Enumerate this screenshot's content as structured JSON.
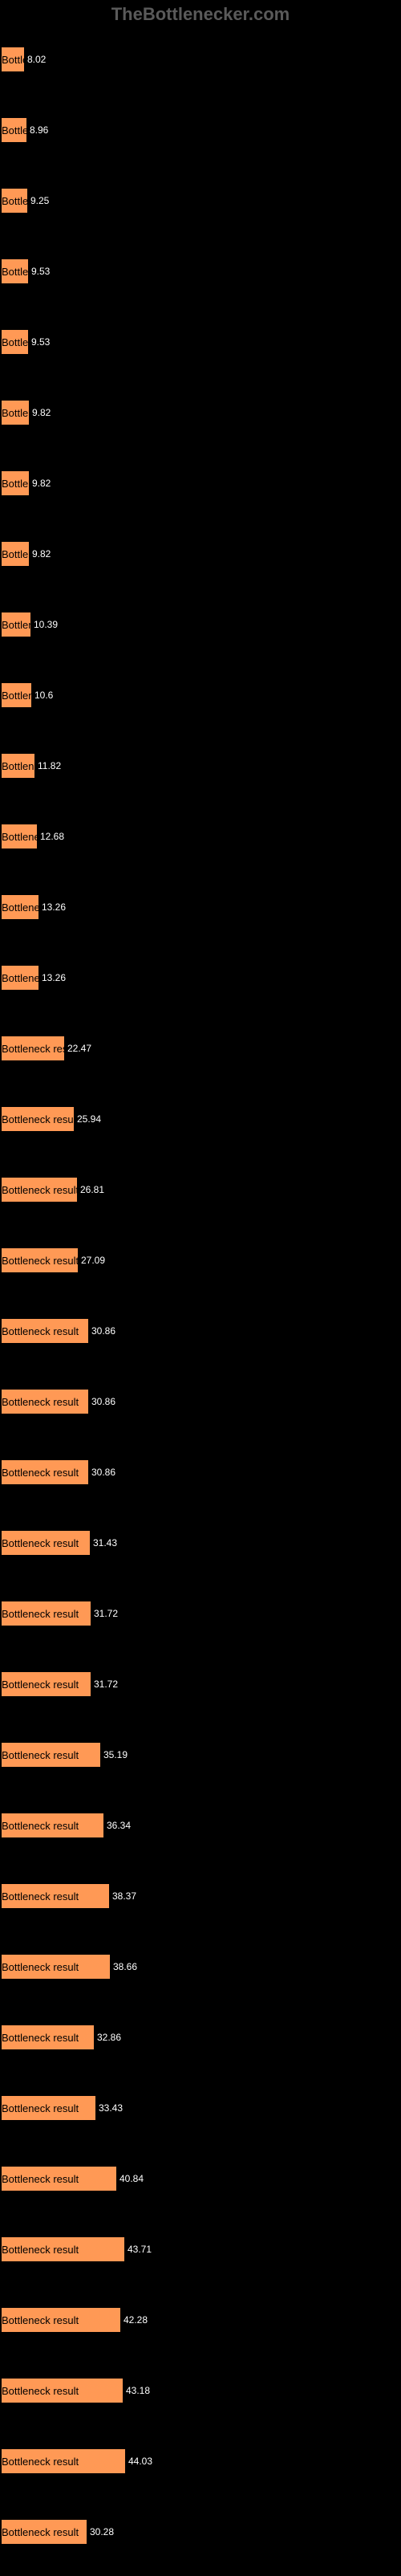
{
  "watermark": "TheBottlenecker.com",
  "chart_data": {
    "type": "bar",
    "title": "",
    "xlabel": "",
    "ylabel": "",
    "max_width": 350,
    "max_value": 100,
    "bars": [
      {
        "label": "Bottleneck result",
        "value": 8.02,
        "width": 28
      },
      {
        "label": "Bottleneck result",
        "value": 8.96,
        "width": 31
      },
      {
        "label": "Bottleneck result",
        "value": 9.25,
        "width": 32
      },
      {
        "label": "Bottleneck result",
        "value": 9.53,
        "width": 33
      },
      {
        "label": "Bottleneck result",
        "value": 9.53,
        "width": 33
      },
      {
        "label": "Bottleneck result",
        "value": 9.82,
        "width": 34
      },
      {
        "label": "Bottleneck result",
        "value": 9.82,
        "width": 34
      },
      {
        "label": "Bottleneck result",
        "value": 9.82,
        "width": 34
      },
      {
        "label": "Bottleneck result",
        "value": 10.39,
        "width": 36
      },
      {
        "label": "Bottleneck result",
        "value": 10.6,
        "width": 37
      },
      {
        "label": "Bottleneck result",
        "value": 11.82,
        "width": 41
      },
      {
        "label": "Bottleneck result",
        "value": 12.68,
        "width": 44
      },
      {
        "label": "Bottleneck result",
        "value": 13.26,
        "width": 46
      },
      {
        "label": "Bottleneck result",
        "value": 13.26,
        "width": 46
      },
      {
        "label": "Bottleneck result",
        "value": 22.47,
        "width": 78
      },
      {
        "label": "Bottleneck result",
        "value": 25.94,
        "width": 90
      },
      {
        "label": "Bottleneck result",
        "value": 26.81,
        "width": 94
      },
      {
        "label": "Bottleneck result",
        "value": 27.09,
        "width": 95
      },
      {
        "label": "Bottleneck result",
        "value": 30.86,
        "width": 108
      },
      {
        "label": "Bottleneck result",
        "value": 30.86,
        "width": 108
      },
      {
        "label": "Bottleneck result",
        "value": 30.86,
        "width": 108
      },
      {
        "label": "Bottleneck result",
        "value": 31.43,
        "width": 110
      },
      {
        "label": "Bottleneck result",
        "value": 31.72,
        "width": 111
      },
      {
        "label": "Bottleneck result",
        "value": 31.72,
        "width": 111
      },
      {
        "label": "Bottleneck result",
        "value": 35.19,
        "width": 123
      },
      {
        "label": "Bottleneck result",
        "value": 36.34,
        "width": 127
      },
      {
        "label": "Bottleneck result",
        "value": 38.37,
        "width": 134
      },
      {
        "label": "Bottleneck result",
        "value": 38.66,
        "width": 135
      },
      {
        "label": "Bottleneck result",
        "value": 32.86,
        "width": 115
      },
      {
        "label": "Bottleneck result",
        "value": 33.43,
        "width": 117
      },
      {
        "label": "Bottleneck result",
        "value": 40.84,
        "width": 143
      },
      {
        "label": "Bottleneck result",
        "value": 43.71,
        "width": 153
      },
      {
        "label": "Bottleneck result",
        "value": 42.28,
        "width": 148
      },
      {
        "label": "Bottleneck result",
        "value": 43.18,
        "width": 151
      },
      {
        "label": "Bottleneck result",
        "value": 44.03,
        "width": 154
      },
      {
        "label": "Bottleneck result",
        "value": 30.28,
        "width": 106
      }
    ]
  }
}
